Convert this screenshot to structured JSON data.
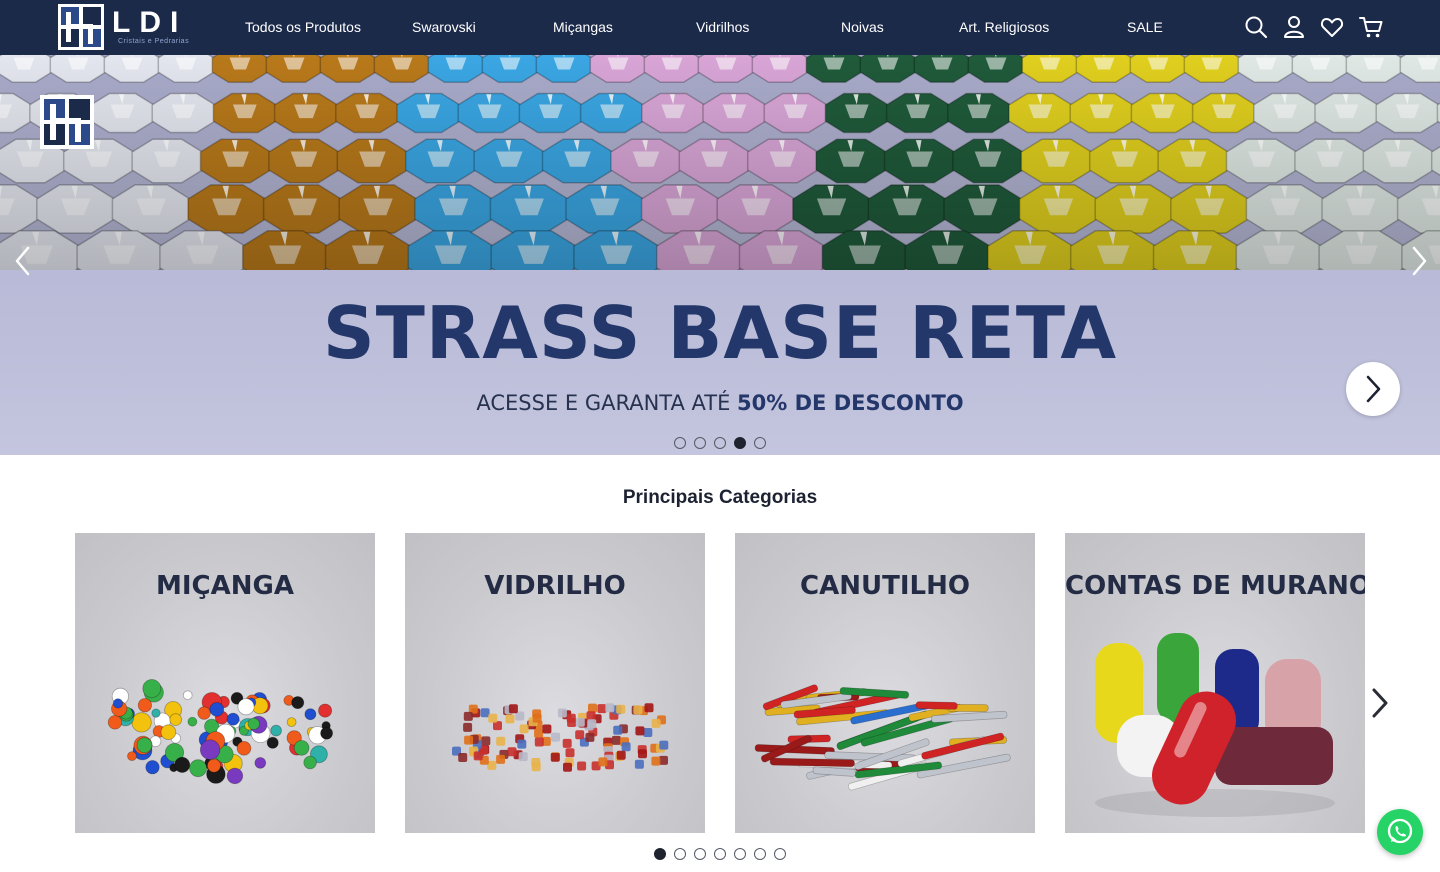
{
  "brand": {
    "name": "LDI",
    "tagline": "Cristais e Pedrarias"
  },
  "nav": {
    "menu": [
      {
        "label": "Todos os Produtos"
      },
      {
        "label": "Swarovski"
      },
      {
        "label": "Miçangas"
      },
      {
        "label": "Vidrilhos"
      },
      {
        "label": "Noivas"
      },
      {
        "label": "Art. Religiosos"
      },
      {
        "label": "SALE"
      }
    ],
    "icons": [
      "search-icon",
      "user-icon",
      "heart-icon",
      "cart-icon"
    ]
  },
  "hero": {
    "title": "STRASS BASE RETA",
    "subtitle_prefix": "ACESSE E GARANTA ATÉ ",
    "subtitle_highlight": "50% DE DESCONTO",
    "slide_count": 5,
    "active_slide": 4,
    "gem_colors": [
      "#e4e6ef",
      "#b8791a",
      "#3aa6e3",
      "#d8a5d6",
      "#1f5a3a",
      "#e0cf1e",
      "#dfe8e4"
    ]
  },
  "categories": {
    "title": "Principais Categorias",
    "items": [
      {
        "label": "MIÇANGA"
      },
      {
        "label": "VIDRILHO"
      },
      {
        "label": "CANUTILHO"
      },
      {
        "label": "CONTAS DE MURANO"
      }
    ],
    "page_count": 7,
    "active_page": 1
  },
  "colors": {
    "navbar": "#1c2a4a",
    "hero_title": "#24376a",
    "whatsapp": "#25d366"
  }
}
